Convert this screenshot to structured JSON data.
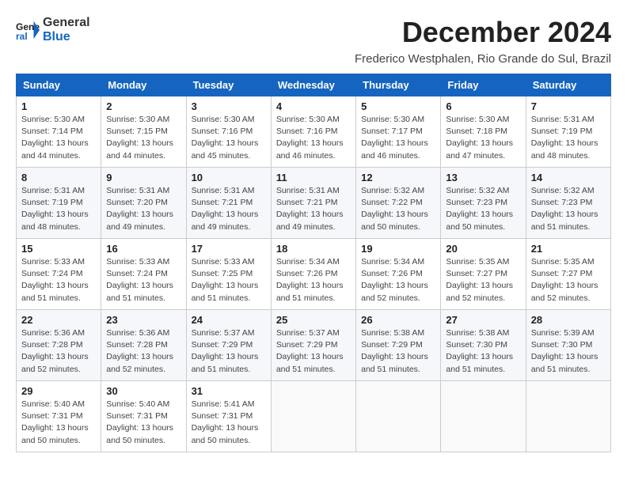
{
  "header": {
    "logo_line1": "General",
    "logo_line2": "Blue",
    "title": "December 2024",
    "subtitle": "Frederico Westphalen, Rio Grande do Sul, Brazil"
  },
  "columns": [
    "Sunday",
    "Monday",
    "Tuesday",
    "Wednesday",
    "Thursday",
    "Friday",
    "Saturday"
  ],
  "weeks": [
    [
      {
        "day": 1,
        "info": "Sunrise: 5:30 AM\nSunset: 7:14 PM\nDaylight: 13 hours\nand 44 minutes."
      },
      {
        "day": 2,
        "info": "Sunrise: 5:30 AM\nSunset: 7:15 PM\nDaylight: 13 hours\nand 44 minutes."
      },
      {
        "day": 3,
        "info": "Sunrise: 5:30 AM\nSunset: 7:16 PM\nDaylight: 13 hours\nand 45 minutes."
      },
      {
        "day": 4,
        "info": "Sunrise: 5:30 AM\nSunset: 7:16 PM\nDaylight: 13 hours\nand 46 minutes."
      },
      {
        "day": 5,
        "info": "Sunrise: 5:30 AM\nSunset: 7:17 PM\nDaylight: 13 hours\nand 46 minutes."
      },
      {
        "day": 6,
        "info": "Sunrise: 5:30 AM\nSunset: 7:18 PM\nDaylight: 13 hours\nand 47 minutes."
      },
      {
        "day": 7,
        "info": "Sunrise: 5:31 AM\nSunset: 7:19 PM\nDaylight: 13 hours\nand 48 minutes."
      }
    ],
    [
      {
        "day": 8,
        "info": "Sunrise: 5:31 AM\nSunset: 7:19 PM\nDaylight: 13 hours\nand 48 minutes."
      },
      {
        "day": 9,
        "info": "Sunrise: 5:31 AM\nSunset: 7:20 PM\nDaylight: 13 hours\nand 49 minutes."
      },
      {
        "day": 10,
        "info": "Sunrise: 5:31 AM\nSunset: 7:21 PM\nDaylight: 13 hours\nand 49 minutes."
      },
      {
        "day": 11,
        "info": "Sunrise: 5:31 AM\nSunset: 7:21 PM\nDaylight: 13 hours\nand 49 minutes."
      },
      {
        "day": 12,
        "info": "Sunrise: 5:32 AM\nSunset: 7:22 PM\nDaylight: 13 hours\nand 50 minutes."
      },
      {
        "day": 13,
        "info": "Sunrise: 5:32 AM\nSunset: 7:23 PM\nDaylight: 13 hours\nand 50 minutes."
      },
      {
        "day": 14,
        "info": "Sunrise: 5:32 AM\nSunset: 7:23 PM\nDaylight: 13 hours\nand 51 minutes."
      }
    ],
    [
      {
        "day": 15,
        "info": "Sunrise: 5:33 AM\nSunset: 7:24 PM\nDaylight: 13 hours\nand 51 minutes."
      },
      {
        "day": 16,
        "info": "Sunrise: 5:33 AM\nSunset: 7:24 PM\nDaylight: 13 hours\nand 51 minutes."
      },
      {
        "day": 17,
        "info": "Sunrise: 5:33 AM\nSunset: 7:25 PM\nDaylight: 13 hours\nand 51 minutes."
      },
      {
        "day": 18,
        "info": "Sunrise: 5:34 AM\nSunset: 7:26 PM\nDaylight: 13 hours\nand 51 minutes."
      },
      {
        "day": 19,
        "info": "Sunrise: 5:34 AM\nSunset: 7:26 PM\nDaylight: 13 hours\nand 52 minutes."
      },
      {
        "day": 20,
        "info": "Sunrise: 5:35 AM\nSunset: 7:27 PM\nDaylight: 13 hours\nand 52 minutes."
      },
      {
        "day": 21,
        "info": "Sunrise: 5:35 AM\nSunset: 7:27 PM\nDaylight: 13 hours\nand 52 minutes."
      }
    ],
    [
      {
        "day": 22,
        "info": "Sunrise: 5:36 AM\nSunset: 7:28 PM\nDaylight: 13 hours\nand 52 minutes."
      },
      {
        "day": 23,
        "info": "Sunrise: 5:36 AM\nSunset: 7:28 PM\nDaylight: 13 hours\nand 52 minutes."
      },
      {
        "day": 24,
        "info": "Sunrise: 5:37 AM\nSunset: 7:29 PM\nDaylight: 13 hours\nand 51 minutes."
      },
      {
        "day": 25,
        "info": "Sunrise: 5:37 AM\nSunset: 7:29 PM\nDaylight: 13 hours\nand 51 minutes."
      },
      {
        "day": 26,
        "info": "Sunrise: 5:38 AM\nSunset: 7:29 PM\nDaylight: 13 hours\nand 51 minutes."
      },
      {
        "day": 27,
        "info": "Sunrise: 5:38 AM\nSunset: 7:30 PM\nDaylight: 13 hours\nand 51 minutes."
      },
      {
        "day": 28,
        "info": "Sunrise: 5:39 AM\nSunset: 7:30 PM\nDaylight: 13 hours\nand 51 minutes."
      }
    ],
    [
      {
        "day": 29,
        "info": "Sunrise: 5:40 AM\nSunset: 7:31 PM\nDaylight: 13 hours\nand 50 minutes."
      },
      {
        "day": 30,
        "info": "Sunrise: 5:40 AM\nSunset: 7:31 PM\nDaylight: 13 hours\nand 50 minutes."
      },
      {
        "day": 31,
        "info": "Sunrise: 5:41 AM\nSunset: 7:31 PM\nDaylight: 13 hours\nand 50 minutes."
      },
      null,
      null,
      null,
      null
    ]
  ]
}
